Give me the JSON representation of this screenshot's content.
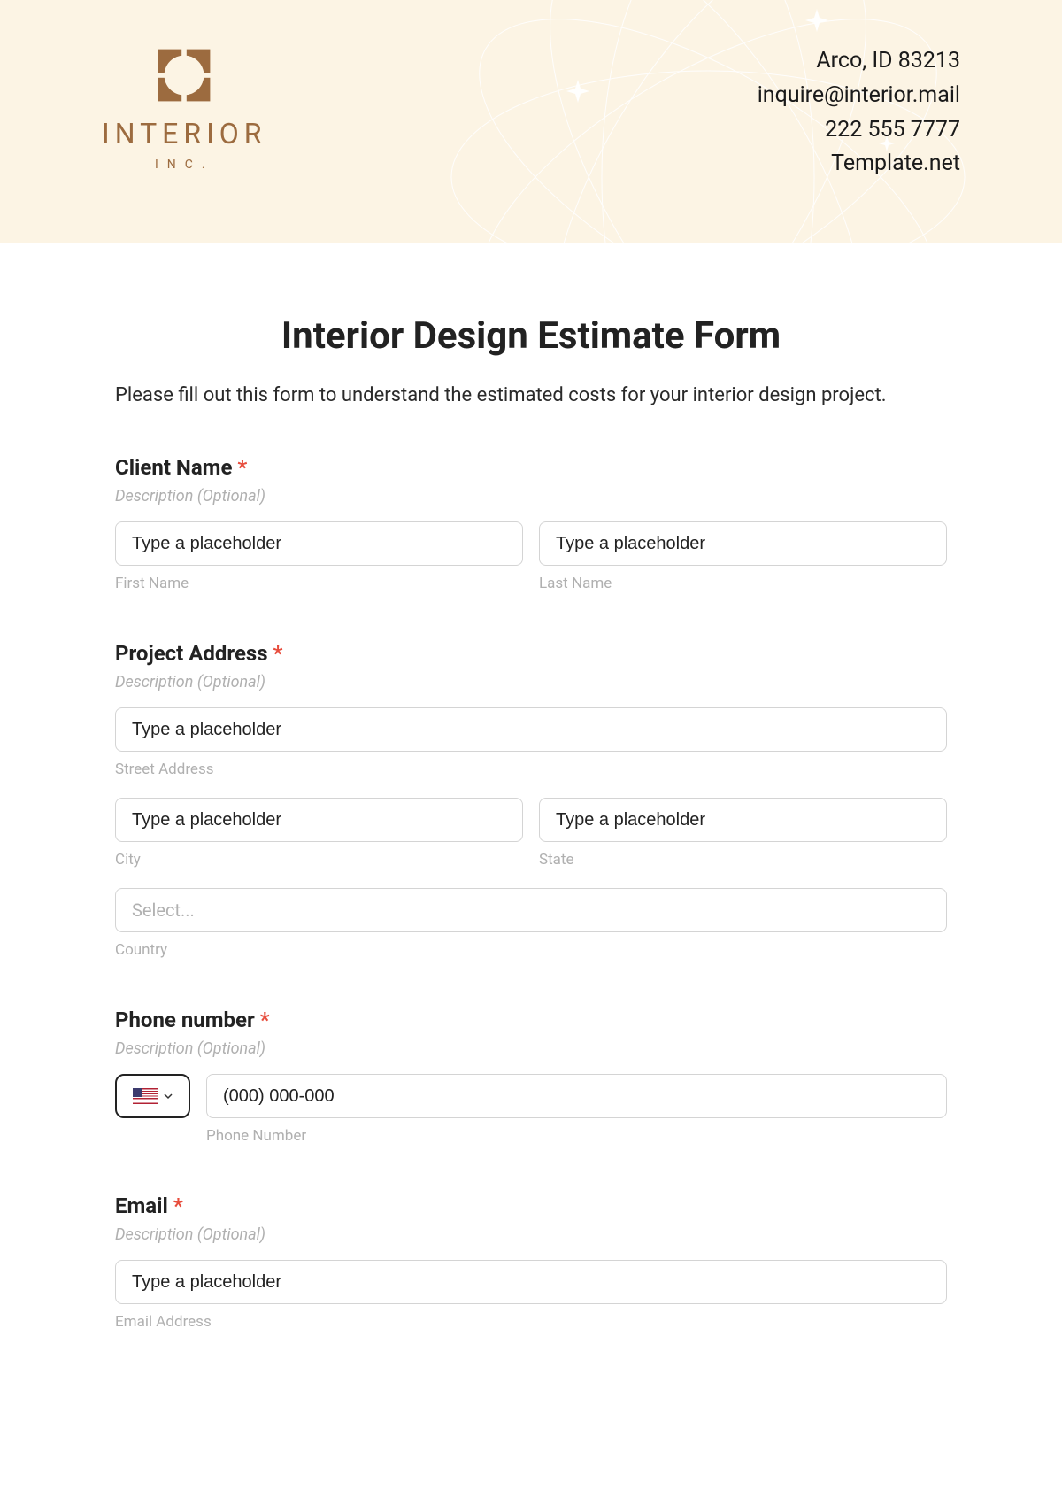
{
  "header": {
    "logo_name": "INTERIOR",
    "logo_sub": "INC.",
    "contact": {
      "address": "Arco, ID 83213",
      "email": "inquire@interior.mail",
      "phone": "222 555 7777",
      "site": "Template.net"
    }
  },
  "form": {
    "title": "Interior Design Estimate Form",
    "intro": "Please fill out this form to understand the estimated costs for your interior design project.",
    "desc_placeholder": "Description (Optional)",
    "text_placeholder": "Type a placeholder",
    "select_placeholder": "Select...",
    "sections": {
      "client_name": {
        "label": "Client Name",
        "first_sub": "First Name",
        "last_sub": "Last Name"
      },
      "project_address": {
        "label": "Project Address",
        "street_sub": "Street Address",
        "city_sub": "City",
        "state_sub": "State",
        "country_sub": "Country"
      },
      "phone": {
        "label": "Phone number",
        "placeholder": "(000) 000-000",
        "sub": "Phone Number"
      },
      "email": {
        "label": "Email",
        "sub": "Email Address"
      }
    }
  }
}
